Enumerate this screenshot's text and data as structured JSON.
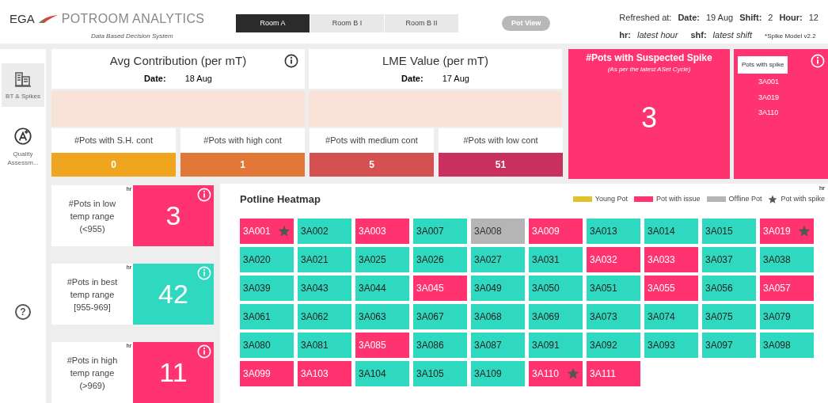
{
  "header": {
    "brand": "EGA",
    "title": "POTROOM ANALYTICS",
    "subtitle": "Data Based Decision System",
    "rooms": [
      {
        "label": "Room A",
        "selected": true
      },
      {
        "label": "Room B I",
        "selected": false
      },
      {
        "label": "Room B II",
        "selected": false
      }
    ],
    "pot_view": "Pot View",
    "refresh": {
      "label": "Refreshed at:",
      "date_label": "Date:",
      "date": "19 Aug",
      "shift_label": "Shift:",
      "shift": "2",
      "hour_label": "Hour:",
      "hour": "12"
    },
    "legend_note": [
      {
        "key": "hr:",
        "value": "latest hour"
      },
      {
        "key": "shf:",
        "value": "latest shift"
      }
    ],
    "model_note": "*Spike Model v2.2"
  },
  "sidebar": {
    "items": [
      {
        "label": "BT & Spikes",
        "selected": true,
        "kind": "building"
      },
      {
        "label": "Quality Assessm...",
        "selected": false,
        "kind": "quality"
      }
    ],
    "help": "?"
  },
  "summary_cards": [
    {
      "title": "Avg Contribution (per mT)",
      "date_label": "Date:",
      "date": "18 Aug"
    },
    {
      "title": "LME Value (per mT)",
      "date_label": "Date:",
      "date": "17 Aug"
    }
  ],
  "contribution_tiles": [
    {
      "label": "#Pots with S.H. cont",
      "value": "0",
      "color": "#f0a51f"
    },
    {
      "label": "#Pots with high cont",
      "value": "1",
      "color": "#e27838"
    },
    {
      "label": "#Pots with medium cont",
      "value": "5",
      "color": "#d55050"
    },
    {
      "label": "#Pots with low cont",
      "value": "51",
      "color": "#c9305f"
    }
  ],
  "spike_card": {
    "title": "#Pots with Suspected Spike",
    "subtitle": "(As per the latest ASet Cycle)",
    "value": "3"
  },
  "spike_list": {
    "title": "Pots with spike",
    "items": [
      "3A001",
      "3A019",
      "3A110"
    ]
  },
  "temp_cards": [
    {
      "label": "#Pots in low temp range (<955)",
      "tag": "hr",
      "value": "3",
      "color": "#ff3370"
    },
    {
      "label": "#Pots in best temp range [955-969]",
      "tag": "hr",
      "value": "42",
      "color": "#2fd9bf"
    },
    {
      "label": "#Pots in high temp range (>969)",
      "tag": "hr",
      "value": "11",
      "color": "#ff3370"
    }
  ],
  "heatmap": {
    "title": "Potline Heatmap",
    "tag": "hr",
    "legend": [
      {
        "label": "Young Pot",
        "kind": "swatch",
        "color": "#e2c02e"
      },
      {
        "label": "Pot with issue",
        "kind": "swatch",
        "color": "#ff3370"
      },
      {
        "label": "Offline Pot",
        "kind": "swatch",
        "color": "#b5b5b5"
      },
      {
        "label": "Pot with spike",
        "kind": "star",
        "color": "#555555"
      }
    ],
    "pots": [
      {
        "id": "3A001",
        "kind": "issue",
        "spike": true
      },
      {
        "id": "3A002",
        "kind": "normal",
        "spike": false
      },
      {
        "id": "3A003",
        "kind": "issue",
        "spike": false
      },
      {
        "id": "3A007",
        "kind": "normal",
        "spike": false
      },
      {
        "id": "3A008",
        "kind": "offline",
        "spike": false
      },
      {
        "id": "3A009",
        "kind": "issue",
        "spike": false
      },
      {
        "id": "3A013",
        "kind": "normal",
        "spike": false
      },
      {
        "id": "3A014",
        "kind": "normal",
        "spike": false
      },
      {
        "id": "3A015",
        "kind": "normal",
        "spike": false
      },
      {
        "id": "3A019",
        "kind": "issue",
        "spike": true
      },
      {
        "id": "3A020",
        "kind": "normal",
        "spike": false
      },
      {
        "id": "3A021",
        "kind": "normal",
        "spike": false
      },
      {
        "id": "3A025",
        "kind": "normal",
        "spike": false
      },
      {
        "id": "3A026",
        "kind": "normal",
        "spike": false
      },
      {
        "id": "3A027",
        "kind": "normal",
        "spike": false
      },
      {
        "id": "3A031",
        "kind": "normal",
        "spike": false
      },
      {
        "id": "3A032",
        "kind": "issue",
        "spike": false
      },
      {
        "id": "3A033",
        "kind": "issue",
        "spike": false
      },
      {
        "id": "3A037",
        "kind": "normal",
        "spike": false
      },
      {
        "id": "3A038",
        "kind": "normal",
        "spike": false
      },
      {
        "id": "3A039",
        "kind": "normal",
        "spike": false
      },
      {
        "id": "3A043",
        "kind": "normal",
        "spike": false
      },
      {
        "id": "3A044",
        "kind": "normal",
        "spike": false
      },
      {
        "id": "3A045",
        "kind": "issue",
        "spike": false
      },
      {
        "id": "3A049",
        "kind": "normal",
        "spike": false
      },
      {
        "id": "3A050",
        "kind": "normal",
        "spike": false
      },
      {
        "id": "3A051",
        "kind": "normal",
        "spike": false
      },
      {
        "id": "3A055",
        "kind": "issue",
        "spike": false
      },
      {
        "id": "3A056",
        "kind": "normal",
        "spike": false
      },
      {
        "id": "3A057",
        "kind": "issue",
        "spike": false
      },
      {
        "id": "3A061",
        "kind": "normal",
        "spike": false
      },
      {
        "id": "3A062",
        "kind": "normal",
        "spike": false
      },
      {
        "id": "3A063",
        "kind": "normal",
        "spike": false
      },
      {
        "id": "3A067",
        "kind": "normal",
        "spike": false
      },
      {
        "id": "3A068",
        "kind": "normal",
        "spike": false
      },
      {
        "id": "3A069",
        "kind": "normal",
        "spike": false
      },
      {
        "id": "3A073",
        "kind": "normal",
        "spike": false
      },
      {
        "id": "3A074",
        "kind": "normal",
        "spike": false
      },
      {
        "id": "3A075",
        "kind": "normal",
        "spike": false
      },
      {
        "id": "3A079",
        "kind": "normal",
        "spike": false
      },
      {
        "id": "3A080",
        "kind": "normal",
        "spike": false
      },
      {
        "id": "3A081",
        "kind": "normal",
        "spike": false
      },
      {
        "id": "3A085",
        "kind": "issue",
        "spike": false
      },
      {
        "id": "3A086",
        "kind": "normal",
        "spike": false
      },
      {
        "id": "3A087",
        "kind": "normal",
        "spike": false
      },
      {
        "id": "3A091",
        "kind": "normal",
        "spike": false
      },
      {
        "id": "3A092",
        "kind": "normal",
        "spike": false
      },
      {
        "id": "3A093",
        "kind": "normal",
        "spike": false
      },
      {
        "id": "3A097",
        "kind": "normal",
        "spike": false
      },
      {
        "id": "3A098",
        "kind": "normal",
        "spike": false
      },
      {
        "id": "3A099",
        "kind": "issue",
        "spike": false
      },
      {
        "id": "3A103",
        "kind": "issue",
        "spike": false
      },
      {
        "id": "3A104",
        "kind": "normal",
        "spike": false
      },
      {
        "id": "3A105",
        "kind": "normal",
        "spike": false
      },
      {
        "id": "3A109",
        "kind": "normal",
        "spike": false
      },
      {
        "id": "3A110",
        "kind": "issue",
        "spike": true
      },
      {
        "id": "3A111",
        "kind": "issue",
        "spike": false
      }
    ]
  }
}
